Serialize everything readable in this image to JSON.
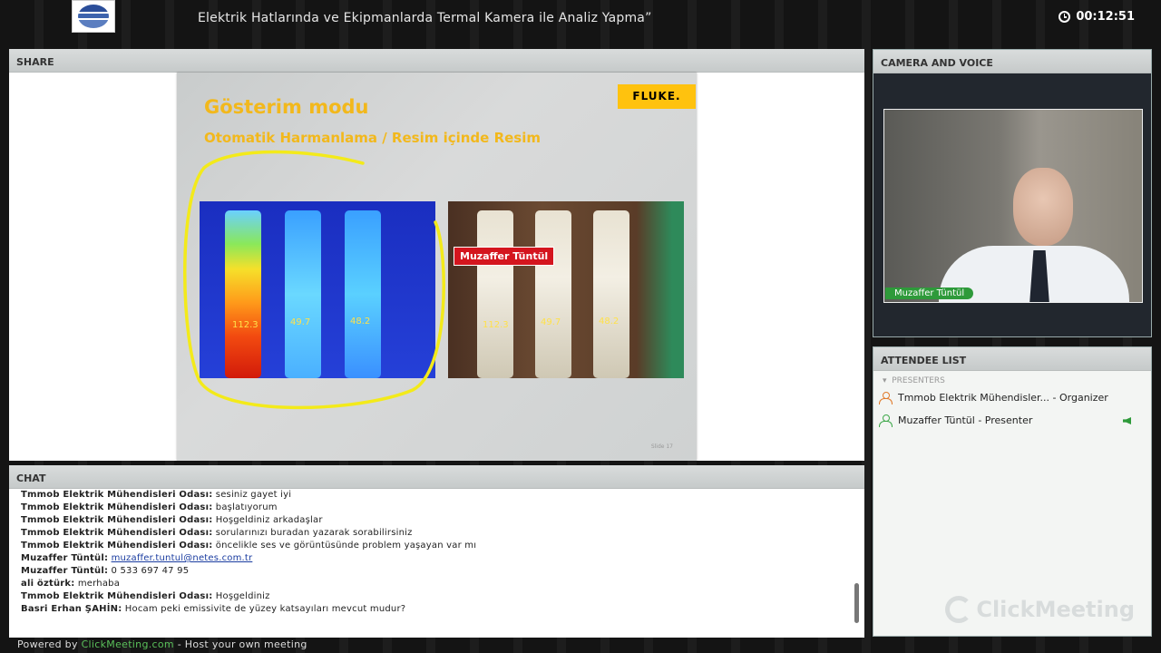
{
  "header": {
    "title": "Elektrik Hatlarında ve Ekipmanlarda Termal Kamera ile Analiz Yapma”",
    "timer": "00:12:51"
  },
  "share": {
    "label": "SHARE",
    "slide": {
      "title": "Gösterim modu",
      "subtitle": "Otomatik Harmanlama  /  Resim içinde Resim",
      "brand": "FLUKE.",
      "thermal_values": [
        "112.3",
        "49.7",
        "48.2"
      ],
      "photo_values": [
        "112.3",
        "49.7",
        "48.2"
      ],
      "slide_number": "Slide 17"
    },
    "pointer_name": "Muzaffer Tüntül"
  },
  "camera": {
    "label": "CAMERA AND VOICE",
    "speaker_name": "Muzaffer Tüntül"
  },
  "attendees": {
    "label": "ATTENDEE LIST",
    "section": "PRESENTERS",
    "items": [
      {
        "name": "Tmmob Elektrik Mühendisler...  - Organizer",
        "color": "#e07a2a"
      },
      {
        "name": "Muzaffer Tüntül - Presenter",
        "color": "#3ea84a"
      }
    ],
    "brand": "ClickMeeting"
  },
  "chat": {
    "label": "CHAT",
    "messages": [
      {
        "who": "Tmmob Elektrik Mühendisleri Odası:",
        "text": " sesiniz gayet iyi"
      },
      {
        "who": "Tmmob Elektrik Mühendisleri Odası:",
        "text": " başlatıyorum"
      },
      {
        "who": "Tmmob Elektrik Mühendisleri Odası:",
        "text": " Hoşgeldiniz arkadaşlar"
      },
      {
        "who": "Tmmob Elektrik Mühendisleri Odası:",
        "text": " sorularınızı buradan yazarak sorabilirsiniz"
      },
      {
        "who": "Tmmob Elektrik Mühendisleri Odası:",
        "text": " öncelikle ses ve görüntüsünde problem yaşayan var mı"
      },
      {
        "who": "Muzaffer Tüntül:",
        "link": "muzaffer.tuntul@netes.com.tr"
      },
      {
        "who": "Muzaffer Tüntül:",
        "text": " 0 533 697 47 95"
      },
      {
        "who": "ali öztürk:",
        "text": " merhaba"
      },
      {
        "who": "Tmmob Elektrik Mühendisleri Odası:",
        "text": " Hoşgeldiniz"
      },
      {
        "who": "Basri Erhan ŞAHİN:",
        "text": " Hocam peki emissivite de yüzey katsayıları mevcut mudur?"
      }
    ]
  },
  "footer": {
    "prefix": "Powered by ",
    "brand": "ClickMeeting.com",
    "suffix": " - Host your own meeting"
  }
}
